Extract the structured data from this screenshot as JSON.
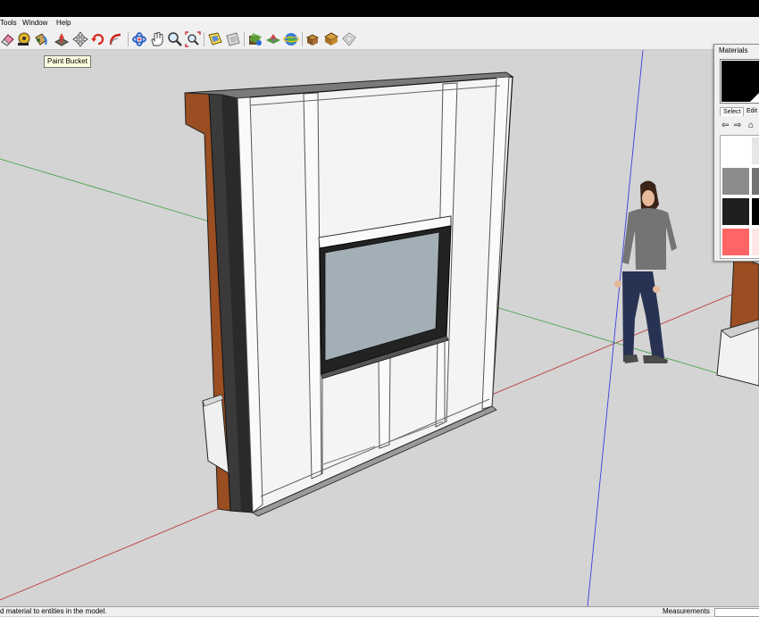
{
  "menu": [
    "Tools",
    "Window",
    "Help"
  ],
  "toolbar": {
    "tools": [
      "eraser-icon",
      "tape-measure-icon",
      "paint-bucket-icon",
      "push-pull-icon",
      "move-icon",
      "rotate-icon",
      "follow-me-icon",
      "orbit-icon",
      "pan-icon",
      "zoom-icon",
      "zoom-extents-icon",
      "get-models-icon",
      "share-model-icon",
      "get-photo-texture-icon",
      "add-location-icon",
      "google-earth-icon",
      "components-icon",
      "extension-warehouse-icon",
      "send-to-layout-icon"
    ],
    "tooltip": "Paint Bucket"
  },
  "materials": {
    "title": "Materials",
    "tab_select": "Select",
    "tab_edit": "Edit",
    "swatches": [
      "#ffffff",
      "#e6e6e6",
      "#8c8c8c",
      "#737373",
      "#1e1e1e",
      "#000000",
      "#ff6565",
      "#ffe5e5"
    ]
  },
  "status": {
    "text": "d material to entities in the model.",
    "measurements_label": "Measurements"
  },
  "colors": {
    "viewport_bg": "#d4d4d4",
    "axis_red": "#c03c3c",
    "axis_green": "#4ca24c",
    "axis_blue": "#3d3de0",
    "wall_face": "#f4f4f4",
    "wood": "#9a4e21",
    "glass": "#a3afb6"
  }
}
